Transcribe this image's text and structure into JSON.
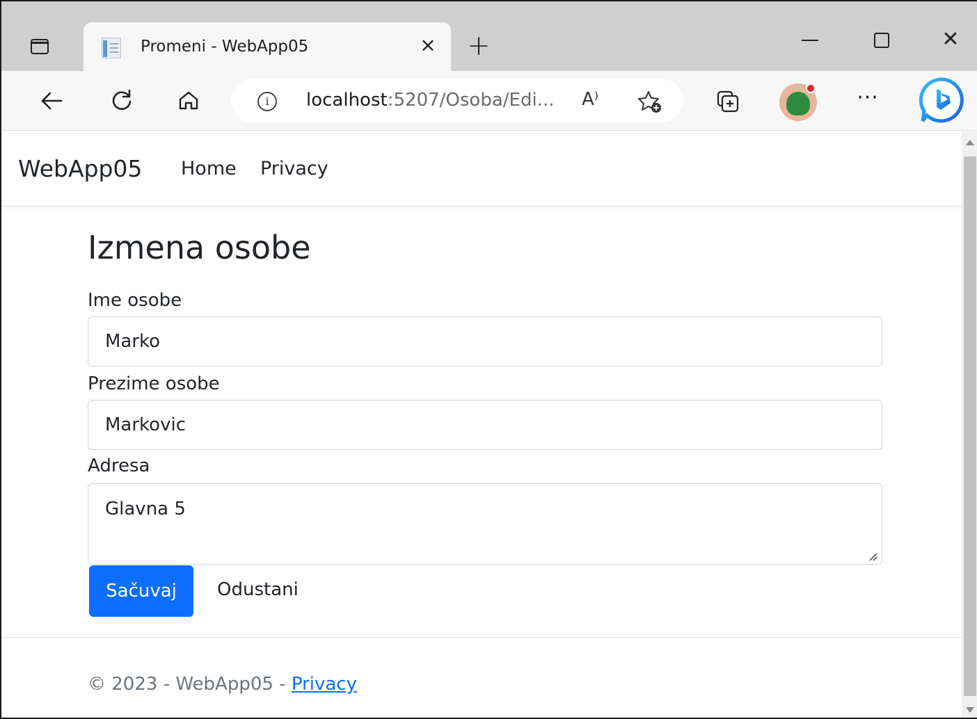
{
  "browser": {
    "tab_title": "Promeni - WebApp05",
    "tab_close_glyph": "×",
    "new_tab_glyph": "+",
    "window_close_glyph": "✕",
    "url_host": "localhost",
    "url_path": ":5207/Osoba/Edi...",
    "read_aloud_glyph": "A⁾",
    "more_glyph": "···",
    "icons": [
      "sidebar-toggle-icon",
      "page-favicon",
      "close-icon",
      "plus-icon",
      "minimize-icon",
      "maximize-icon",
      "window-close-icon",
      "back-arrow-icon",
      "refresh-icon",
      "home-icon",
      "info-icon",
      "read-aloud-icon",
      "add-favorite-icon",
      "collections-icon",
      "profile-avatar",
      "more-icon",
      "bing-icon"
    ]
  },
  "navbar": {
    "brand": "WebApp05",
    "links": [
      {
        "label": "Home"
      },
      {
        "label": "Privacy"
      }
    ]
  },
  "form": {
    "title": "Izmena osobe",
    "first_name_label": "Ime osobe",
    "first_name_value": "Marko",
    "last_name_label": "Prezime osobe",
    "last_name_value": "Markovic",
    "address_label": "Adresa",
    "address_value": "Glavna 5",
    "save_label": "Sačuvaj",
    "cancel_label": "Odustani"
  },
  "footer": {
    "text": "© 2023 - WebApp05 - ",
    "link": "Privacy"
  },
  "colors": {
    "primary": "#0d6efd",
    "text": "#212529",
    "muted": "#6c757d",
    "border": "#ced4da",
    "tabstrip": "#cfcfcf",
    "toolbar": "#f7f7f7"
  }
}
